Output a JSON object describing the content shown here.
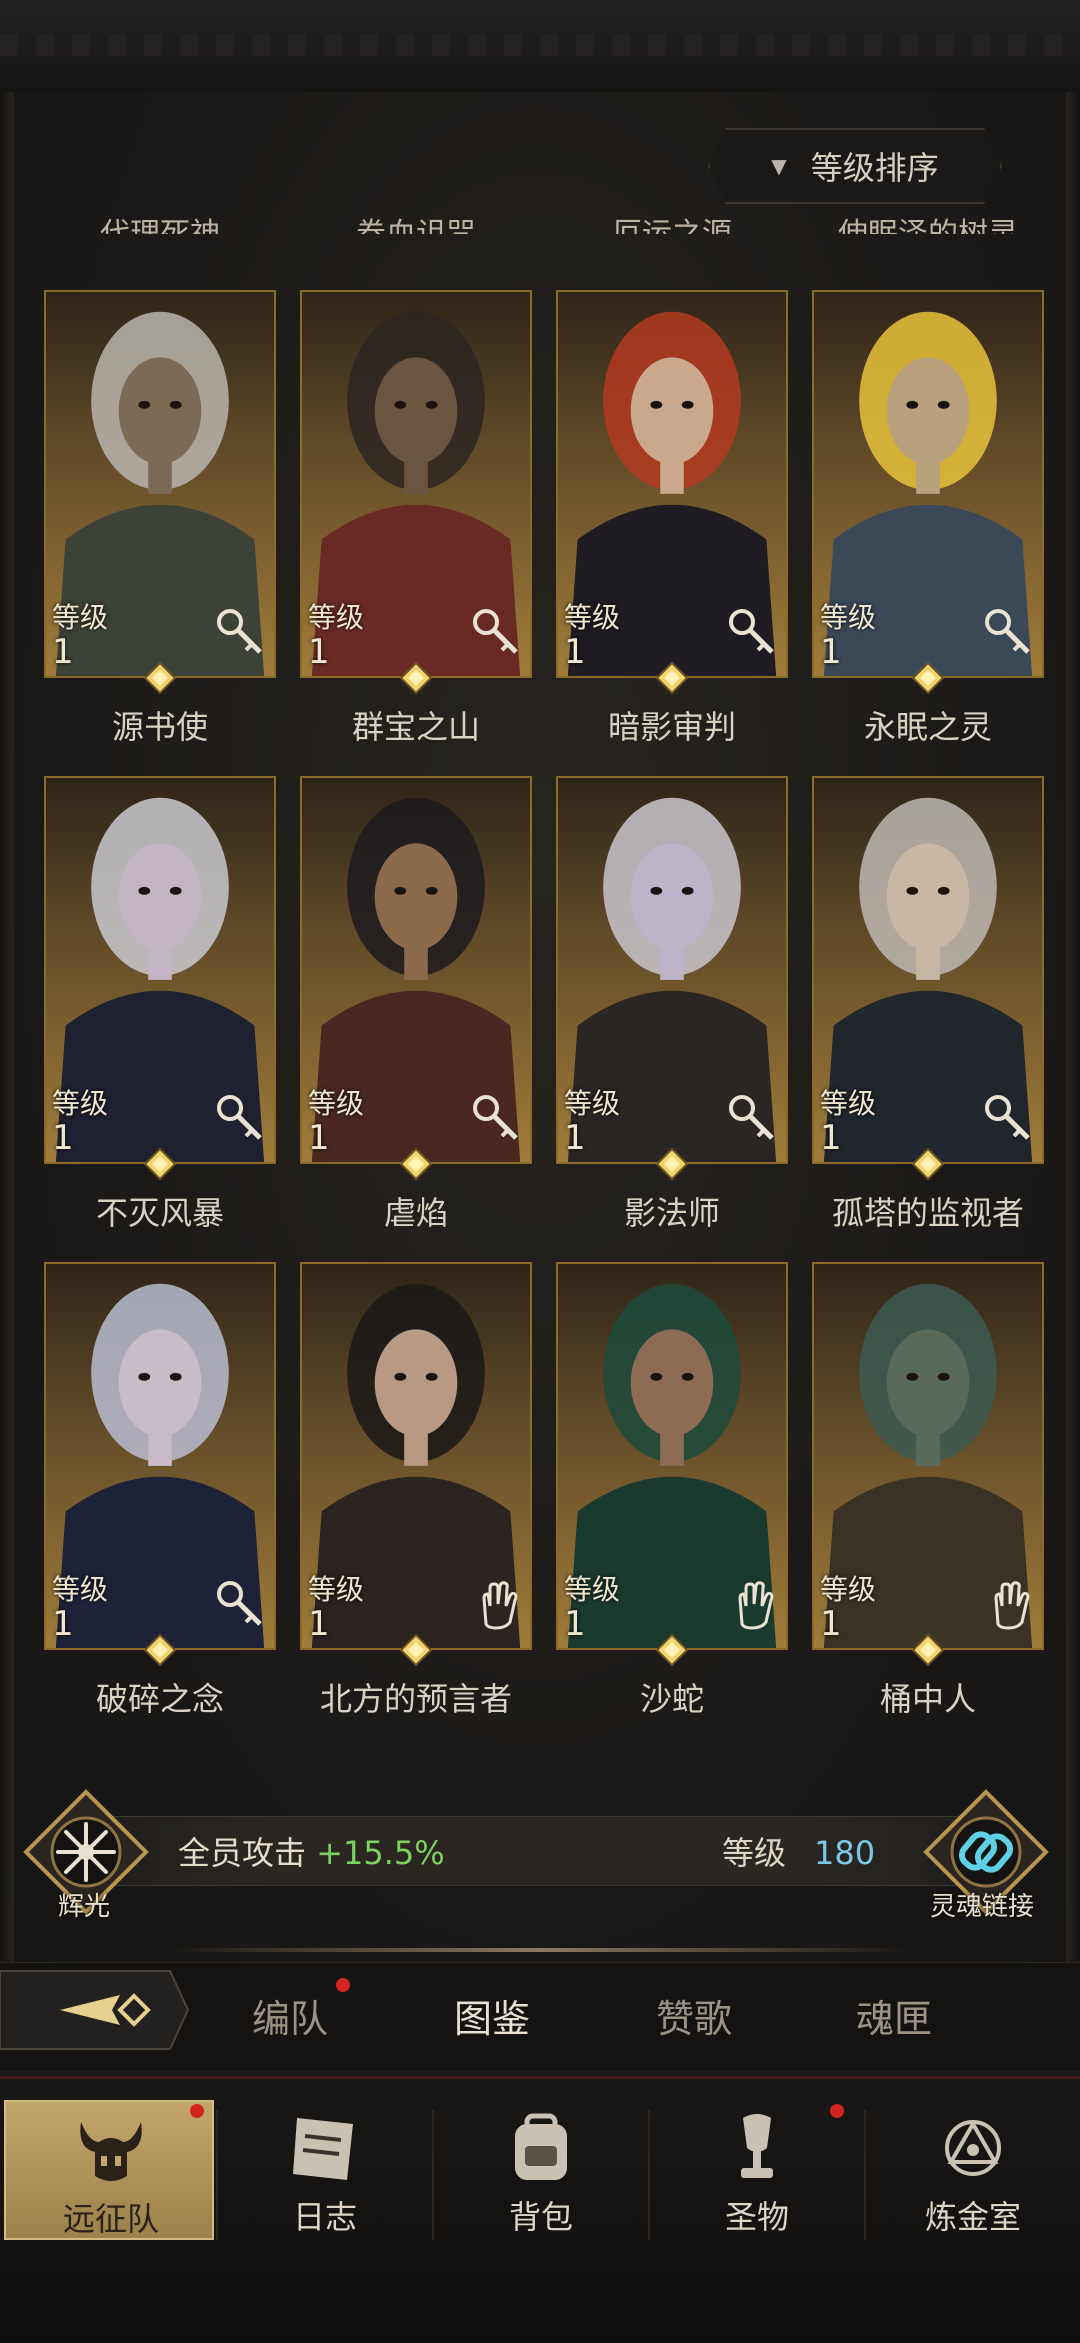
{
  "sort": {
    "label": "等级排序"
  },
  "top_names": [
    "代理死神",
    "卷血诅咒",
    "厄运之源",
    "伸眠泽的树灵"
  ],
  "level_label": "等级",
  "cards": [
    {
      "name": "源书使",
      "level": "1",
      "class_icon": "key-icon"
    },
    {
      "name": "群宝之山",
      "level": "1",
      "class_icon": "key-icon"
    },
    {
      "name": "暗影审判",
      "level": "1",
      "class_icon": "key-icon"
    },
    {
      "name": "永眠之灵",
      "level": "1",
      "class_icon": "key-icon"
    },
    {
      "name": "不灭风暴",
      "level": "1",
      "class_icon": "key-icon"
    },
    {
      "name": "虐焰",
      "level": "1",
      "class_icon": "key-icon"
    },
    {
      "name": "影法师",
      "level": "1",
      "class_icon": "key-icon"
    },
    {
      "name": "孤塔的监视者",
      "level": "1",
      "class_icon": "key-icon"
    },
    {
      "name": "破碎之念",
      "level": "1",
      "class_icon": "key-icon"
    },
    {
      "name": "北方的预言者",
      "level": "1",
      "class_icon": "hand-icon"
    },
    {
      "name": "沙蛇",
      "level": "1",
      "class_icon": "hand-icon"
    },
    {
      "name": "桶中人",
      "level": "1",
      "class_icon": "hand-icon"
    }
  ],
  "bonus": {
    "radiance_label": "辉光",
    "attack_label": "全员攻击",
    "attack_value": "+15.5%",
    "level_label": "等级",
    "level_value": "180",
    "soul_link_label": "灵魂链接"
  },
  "tabs": [
    {
      "label": "编队",
      "badge": true
    },
    {
      "label": "图鉴",
      "active": true
    },
    {
      "label": "赞歌"
    },
    {
      "label": "魂匣"
    }
  ],
  "bottom_nav": [
    {
      "label": "远征队",
      "icon": "horned-helmet-icon",
      "active": true,
      "badge": true
    },
    {
      "label": "日志",
      "icon": "scroll-icon"
    },
    {
      "label": "背包",
      "icon": "backpack-icon"
    },
    {
      "label": "圣物",
      "icon": "chalice-icon",
      "badge": true
    },
    {
      "label": "炼金室",
      "icon": "alchemy-icon"
    }
  ],
  "colors": {
    "gold": "#a07c3a",
    "green": "#7ed05f",
    "blue": "#7cc6e8",
    "badge": "#d2251f"
  }
}
